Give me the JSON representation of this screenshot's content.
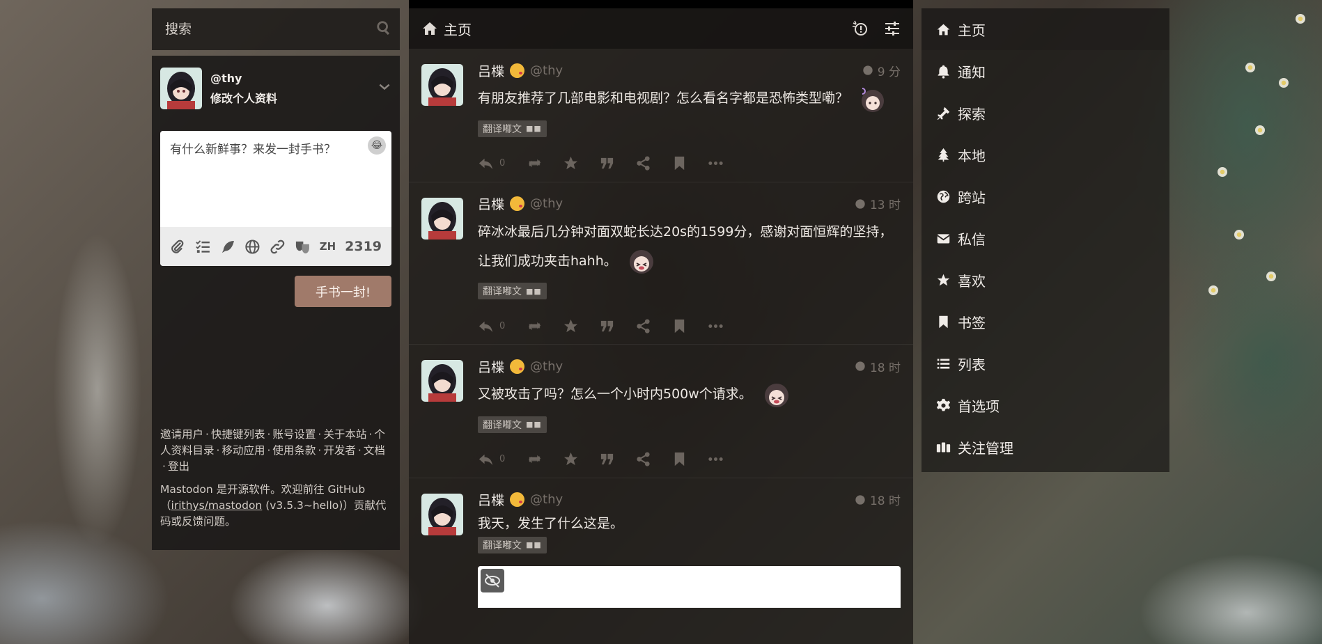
{
  "search": {
    "placeholder": "搜索"
  },
  "account": {
    "handle": "@thy",
    "edit_profile": "修改个人资料"
  },
  "compose": {
    "placeholder": "有什么新鲜事？来发一封手书？",
    "language": "ZH",
    "char_count": "2319",
    "publish_label": "手书一封!"
  },
  "footer": {
    "links": [
      "邀请用户",
      "快捷键列表",
      "账号设置",
      "关于本站",
      "个人资料目录",
      "移动应用",
      "使用条款",
      "开发者",
      "文档",
      "登出"
    ],
    "info_prefix": "Mastodon 是开源软件。欢迎前往 GitHub（",
    "repo_link": "irithys/mastodon",
    "info_suffix": " (v3.5.3~hello)）贡献代码或反馈问题。"
  },
  "column": {
    "title": "主页"
  },
  "statuses": [
    {
      "name": "吕楪",
      "handle": "@thy",
      "time": "9 分",
      "content": "有朋友推荐了几部电影和电视剧？怎么看名字都是恐怖类型嘞？",
      "sticker": "spiral-girl-sticker",
      "translate": "翻译嘟文",
      "reply_count": "0"
    },
    {
      "name": "吕楪",
      "handle": "@thy",
      "time": "13 时",
      "content": "碎冰冰最后几分钟对面双蛇长达20s的1599分，感谢对面恒辉的坚持，让我们成功夹击hahh。",
      "sticker": "crying-girl-sticker",
      "translate": "翻译嘟文",
      "reply_count": "0"
    },
    {
      "name": "吕楪",
      "handle": "@thy",
      "time": "18 时",
      "content": "又被攻击了吗？怎么一个小时内500w个请求。",
      "sticker": "crying-girl-sticker",
      "translate": "翻译嘟文",
      "reply_count": "0"
    },
    {
      "name": "吕楪",
      "handle": "@thy",
      "time": "18 时",
      "content": "我天，发生了什么这是。",
      "sticker": "",
      "translate": "翻译嘟文",
      "reply_count": ""
    }
  ],
  "nav": [
    {
      "label": "主页",
      "icon": "home-icon"
    },
    {
      "label": "通知",
      "icon": "bell-icon"
    },
    {
      "label": "探索",
      "icon": "hashtag-icon"
    },
    {
      "label": "本地",
      "icon": "tree-icon"
    },
    {
      "label": "跨站",
      "icon": "globe-icon"
    },
    {
      "label": "私信",
      "icon": "envelope-icon"
    },
    {
      "label": "喜欢",
      "icon": "star-icon"
    },
    {
      "label": "书签",
      "icon": "bookmark-icon"
    },
    {
      "label": "列表",
      "icon": "list-icon"
    },
    {
      "label": "首选项",
      "icon": "gear-icon"
    },
    {
      "label": "关注管理",
      "icon": "users-icon"
    }
  ],
  "colors": {
    "accent": "#a07a6a",
    "panel": "#1e1b19",
    "muted": "#77706a"
  }
}
